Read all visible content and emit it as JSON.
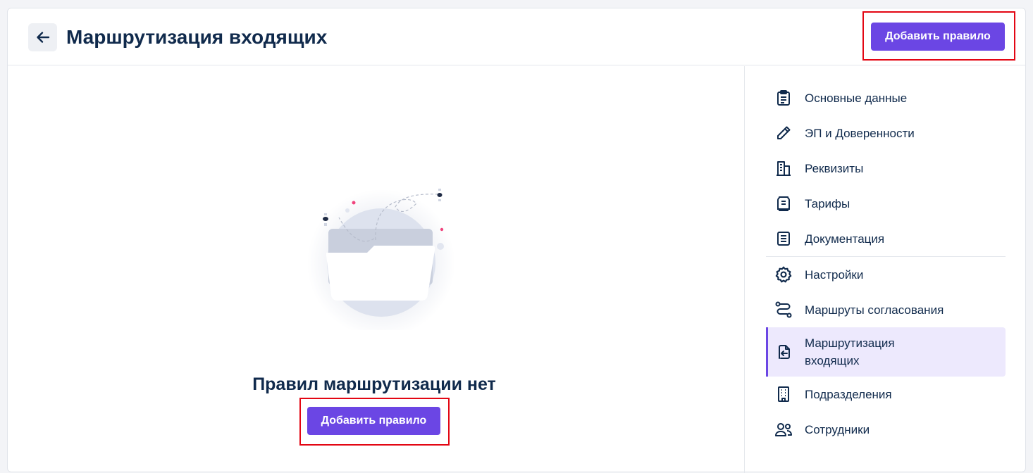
{
  "header": {
    "title": "Маршрутизация входящих",
    "add_button": "Добавить правило"
  },
  "main": {
    "empty_title": "Правил маршрутизации нет",
    "add_button": "Добавить правило"
  },
  "sidebar": {
    "items": [
      {
        "label": "Основные данные",
        "icon": "clipboard-icon"
      },
      {
        "label": "ЭП и Доверенности",
        "icon": "pen-icon"
      },
      {
        "label": "Реквизиты",
        "icon": "bank-icon"
      },
      {
        "label": "Тарифы",
        "icon": "receipt-icon"
      },
      {
        "label": "Документация",
        "icon": "document-icon"
      },
      {
        "label": "Настройки",
        "icon": "gear-icon"
      },
      {
        "label": "Маршруты согласования",
        "icon": "route-icon"
      },
      {
        "label": "Маршрутизация входящих",
        "icon": "incoming-doc-icon"
      },
      {
        "label": "Подразделения",
        "icon": "building-icon"
      },
      {
        "label": "Сотрудники",
        "icon": "users-icon"
      }
    ],
    "active_index": 7
  },
  "colors": {
    "accent": "#6b46e4",
    "text": "#102a4c",
    "highlight": "#e30613"
  }
}
